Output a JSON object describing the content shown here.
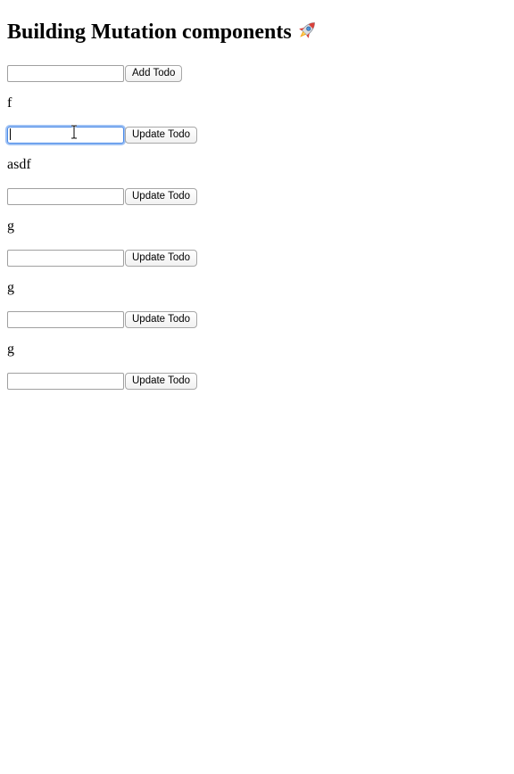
{
  "header": {
    "title": "Building Mutation components",
    "emoji_icon": "rocket-icon"
  },
  "add_form": {
    "input_value": "",
    "button_label": "Add Todo"
  },
  "todos": [
    {
      "name": "f",
      "input_value": "",
      "button_label": "Update Todo",
      "focused": true
    },
    {
      "name": "asdf",
      "input_value": "",
      "button_label": "Update Todo",
      "focused": false
    },
    {
      "name": "g",
      "input_value": "",
      "button_label": "Update Todo",
      "focused": false
    },
    {
      "name": "g",
      "input_value": "",
      "button_label": "Update Todo",
      "focused": false
    },
    {
      "name": "g",
      "input_value": "",
      "button_label": "Update Todo",
      "focused": false
    }
  ],
  "colors": {
    "focus_ring": "#9ec1f4",
    "focus_border": "#4a8ae8"
  }
}
